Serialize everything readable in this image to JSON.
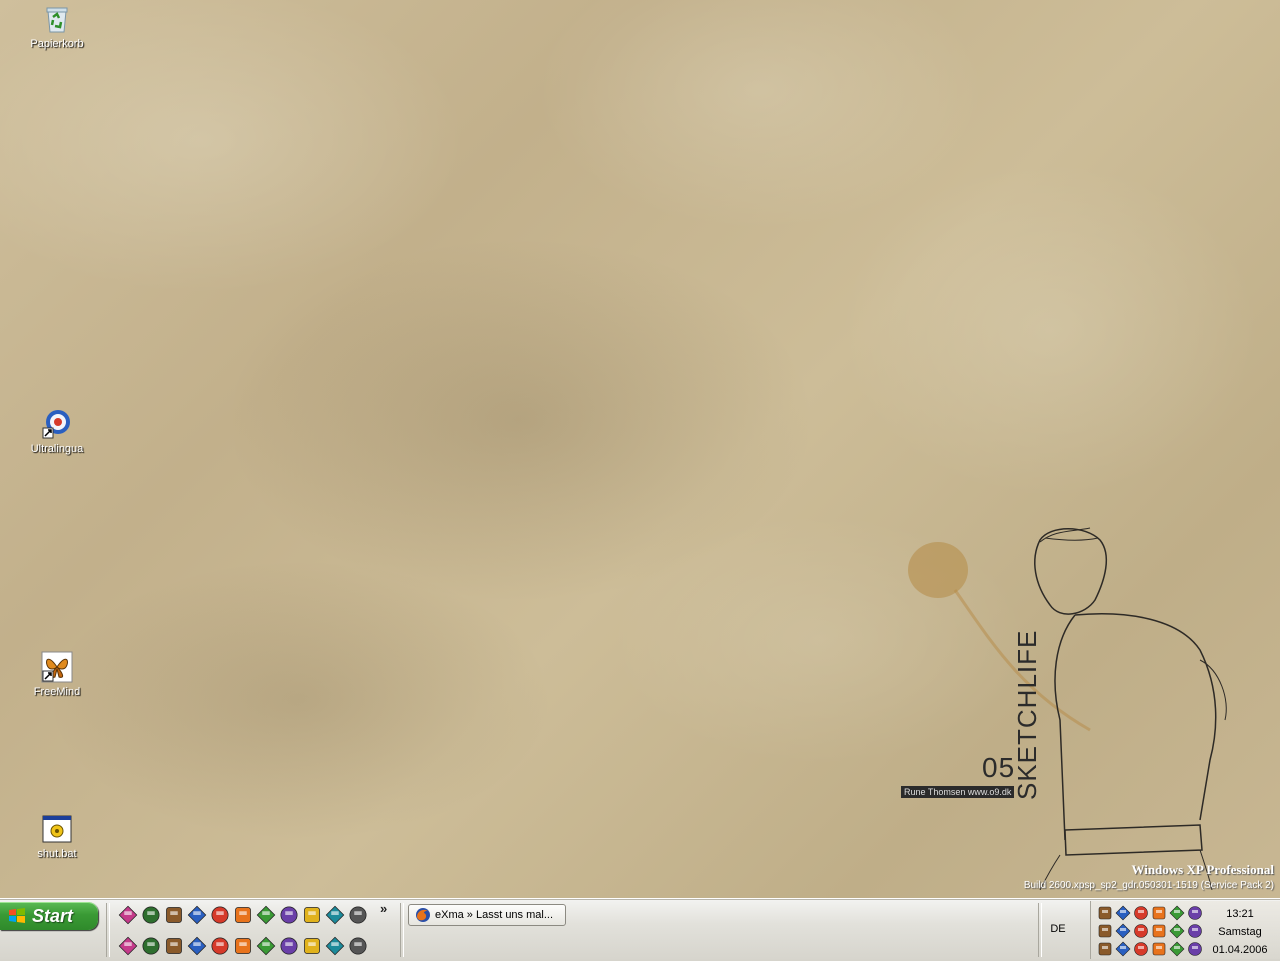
{
  "desktop": {
    "icons": [
      {
        "label": "Papierkorb",
        "icon": "recycle-bin-icon"
      },
      {
        "label": "Ultralingua",
        "icon": "ultralingua-icon"
      },
      {
        "label": "FreeMind",
        "icon": "freemind-butterfly-icon"
      },
      {
        "label": "shut.bat",
        "icon": "batch-file-icon"
      }
    ],
    "wallpaper": {
      "number": "05",
      "title": "SKETCHLIFE",
      "credit": "Rune Thomsen www.o9.dk"
    },
    "os_watermark": {
      "title": "Windows XP Professional",
      "build": "Build 2600.xpsp_sp2_gdr.050301-1519 (Service Pack 2)"
    }
  },
  "taskbar": {
    "start_label": "Start",
    "quick_launch_row1": [
      "ie-icon",
      "save-icon",
      "firefox-icon",
      "network-icon",
      "media-icon",
      "winamp-icon",
      "flower-icon",
      "calculator-icon",
      "settings-icon",
      "paint-icon",
      "play-icon"
    ],
    "quick_launch_row2": [
      "cmd-icon",
      "globe-icon",
      "tree-icon",
      "grid-icon",
      "desktop-icon",
      "monkey-icon",
      "network-computer-icon",
      "web-icon",
      "music-icon",
      "box-icon",
      "tool-icon"
    ],
    "chevron": "»",
    "task_buttons": [
      {
        "label": "eXma » Lasst uns mal...",
        "icon": "firefox-icon"
      }
    ],
    "language": "DE",
    "tray": {
      "row1": [
        "floppy-icon",
        "network-tray-icon",
        "globe-tray-icon",
        "ati-icon",
        "close-tray-icon",
        "help-icon"
      ],
      "row2": [
        "security-icon",
        "battery-icon",
        "bluetooth-icon",
        "monitor-icon",
        "updown-icon",
        "share-icon"
      ],
      "row3": [
        "java-icon",
        "connect-icon",
        "clock-icon",
        "usb-icon",
        "refresh-icon",
        "mail-icon"
      ]
    },
    "clock": {
      "time": "13:21",
      "day": "Samstag",
      "date": "01.04.2006"
    }
  },
  "colors": {
    "start_green": "#3a9a35",
    "taskbar_bg": "#e2e1db"
  }
}
